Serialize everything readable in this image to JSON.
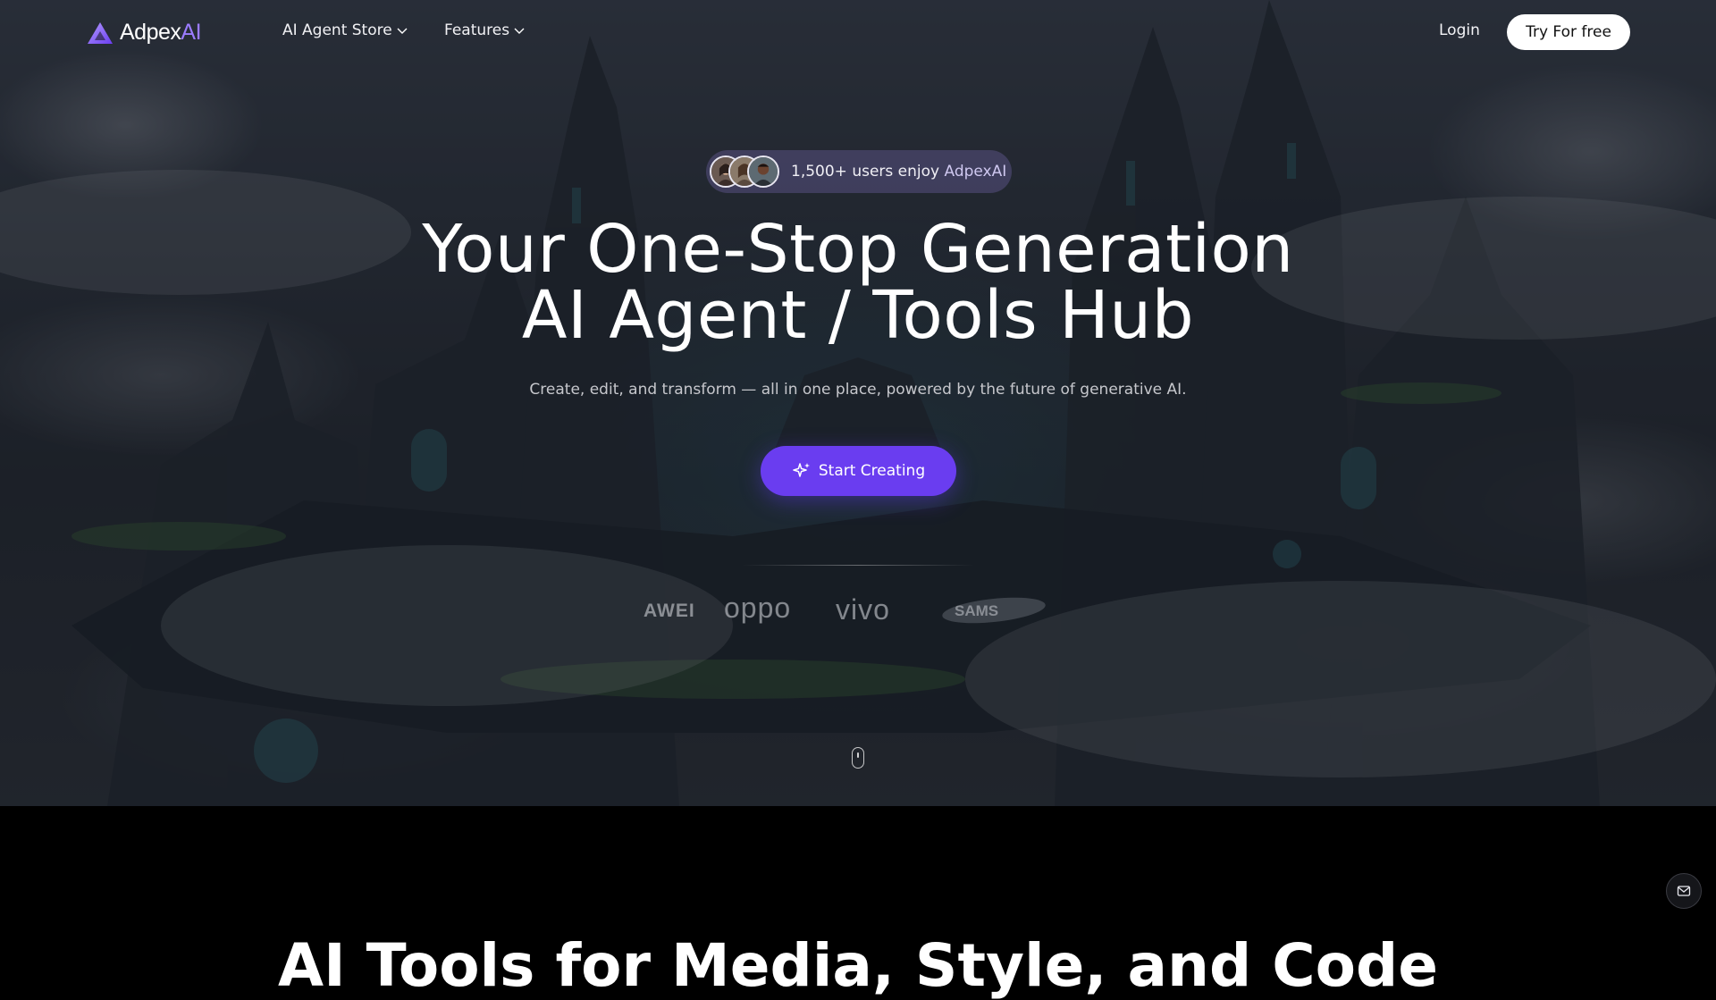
{
  "brand": {
    "name_main": "Adpex",
    "name_accent": "AI",
    "accent_color": "#9b7cff"
  },
  "nav": {
    "items": [
      {
        "label": "AI Agent Store",
        "icon": "chevron-down-icon"
      },
      {
        "label": "Features",
        "icon": "chevron-down-icon"
      }
    ],
    "login_label": "Login",
    "cta_label": "Try For free"
  },
  "hero": {
    "users_badge": {
      "count_text": "1,500+ users enjoy ",
      "brand_text": "AdpexAI"
    },
    "headline_line1": "Your One-Stop Generation",
    "headline_line2": "AI Agent / Tools Hub",
    "subheadline": "Create, edit, and transform — all in one place, powered by the future of generative AI.",
    "cta_label": "Start Creating",
    "cta_color": "#6a3df0",
    "partner_logos": [
      "AWEI",
      "oppo",
      "vivo",
      "SAMS"
    ]
  },
  "section2": {
    "title": "AI Tools for Media, Style, and Code"
  },
  "floating": {
    "icon": "mail-icon"
  }
}
